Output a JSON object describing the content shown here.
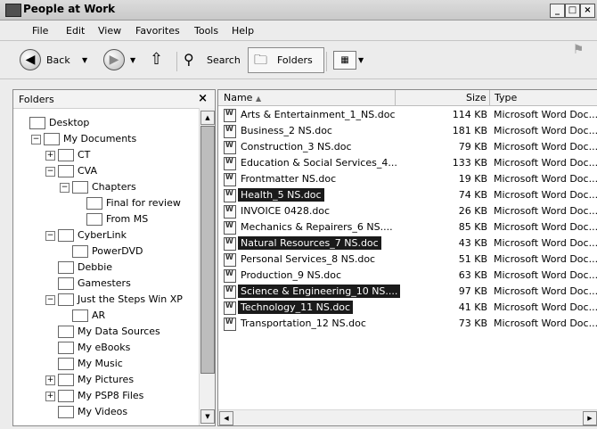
{
  "window": {
    "title": "People at Work",
    "controls": [
      "_",
      "□",
      "×"
    ]
  },
  "menu": [
    "File",
    "Edit",
    "View",
    "Favorites",
    "Tools",
    "Help"
  ],
  "toolbar": {
    "back_label": "Back",
    "search_label": "Search",
    "folders_label": "Folders"
  },
  "folders_pane": {
    "title": "Folders",
    "close": "×",
    "items": [
      {
        "label": "Desktop",
        "level": 0,
        "expander": ""
      },
      {
        "label": "My Documents",
        "level": 1,
        "expander": "−"
      },
      {
        "label": "CT",
        "level": 2,
        "expander": "+"
      },
      {
        "label": "CVA",
        "level": 2,
        "expander": "−"
      },
      {
        "label": "Chapters",
        "level": 3,
        "expander": "−"
      },
      {
        "label": "Final for review",
        "level": 4,
        "expander": ""
      },
      {
        "label": "From MS",
        "level": 4,
        "expander": ""
      },
      {
        "label": "CyberLink",
        "level": 2,
        "expander": "−"
      },
      {
        "label": "PowerDVD",
        "level": 3,
        "expander": ""
      },
      {
        "label": "Debbie",
        "level": 2,
        "expander": ""
      },
      {
        "label": "Gamesters",
        "level": 2,
        "expander": ""
      },
      {
        "label": "Just the Steps Win XP",
        "level": 2,
        "expander": "−"
      },
      {
        "label": "AR",
        "level": 3,
        "expander": ""
      },
      {
        "label": "My Data Sources",
        "level": 2,
        "expander": ""
      },
      {
        "label": "My eBooks",
        "level": 2,
        "expander": ""
      },
      {
        "label": "My Music",
        "level": 2,
        "expander": ""
      },
      {
        "label": "My Pictures",
        "level": 2,
        "expander": "+"
      },
      {
        "label": "My PSP8 Files",
        "level": 2,
        "expander": "+"
      },
      {
        "label": "My Videos",
        "level": 2,
        "expander": ""
      }
    ]
  },
  "file_list": {
    "columns": {
      "name": "Name",
      "size": "Size",
      "type": "Type"
    },
    "files": [
      {
        "name": "Arts & Entertainment_1_NS.doc",
        "size": "114 KB",
        "type": "Microsoft Word Doc...",
        "selected": false
      },
      {
        "name": "Business_2 NS.doc",
        "size": "181 KB",
        "type": "Microsoft Word Doc...",
        "selected": false
      },
      {
        "name": "Construction_3 NS.doc",
        "size": "79 KB",
        "type": "Microsoft Word Doc...",
        "selected": false
      },
      {
        "name": "Education & Social Services_4...",
        "size": "133 KB",
        "type": "Microsoft Word Doc...",
        "selected": false
      },
      {
        "name": "Frontmatter NS.doc",
        "size": "19 KB",
        "type": "Microsoft Word Doc...",
        "selected": false
      },
      {
        "name": "Health_5 NS.doc",
        "size": "74 KB",
        "type": "Microsoft Word Doc...",
        "selected": true
      },
      {
        "name": "INVOICE 0428.doc",
        "size": "26 KB",
        "type": "Microsoft Word Doc...",
        "selected": false
      },
      {
        "name": "Mechanics & Repairers_6 NS....",
        "size": "85 KB",
        "type": "Microsoft Word Doc...",
        "selected": false
      },
      {
        "name": "Natural Resources_7 NS.doc",
        "size": "43 KB",
        "type": "Microsoft Word Doc...",
        "selected": true
      },
      {
        "name": "Personal Services_8 NS.doc",
        "size": "51 KB",
        "type": "Microsoft Word Doc...",
        "selected": false
      },
      {
        "name": "Production_9 NS.doc",
        "size": "63 KB",
        "type": "Microsoft Word Doc...",
        "selected": false
      },
      {
        "name": "Science & Engineering_10 NS....",
        "size": "97 KB",
        "type": "Microsoft Word Doc...",
        "selected": true
      },
      {
        "name": "Technology_11 NS.doc",
        "size": "41 KB",
        "type": "Microsoft Word Doc...",
        "selected": true
      },
      {
        "name": "Transportation_12 NS.doc",
        "size": "73 KB",
        "type": "Microsoft Word Doc...",
        "selected": false
      }
    ]
  }
}
